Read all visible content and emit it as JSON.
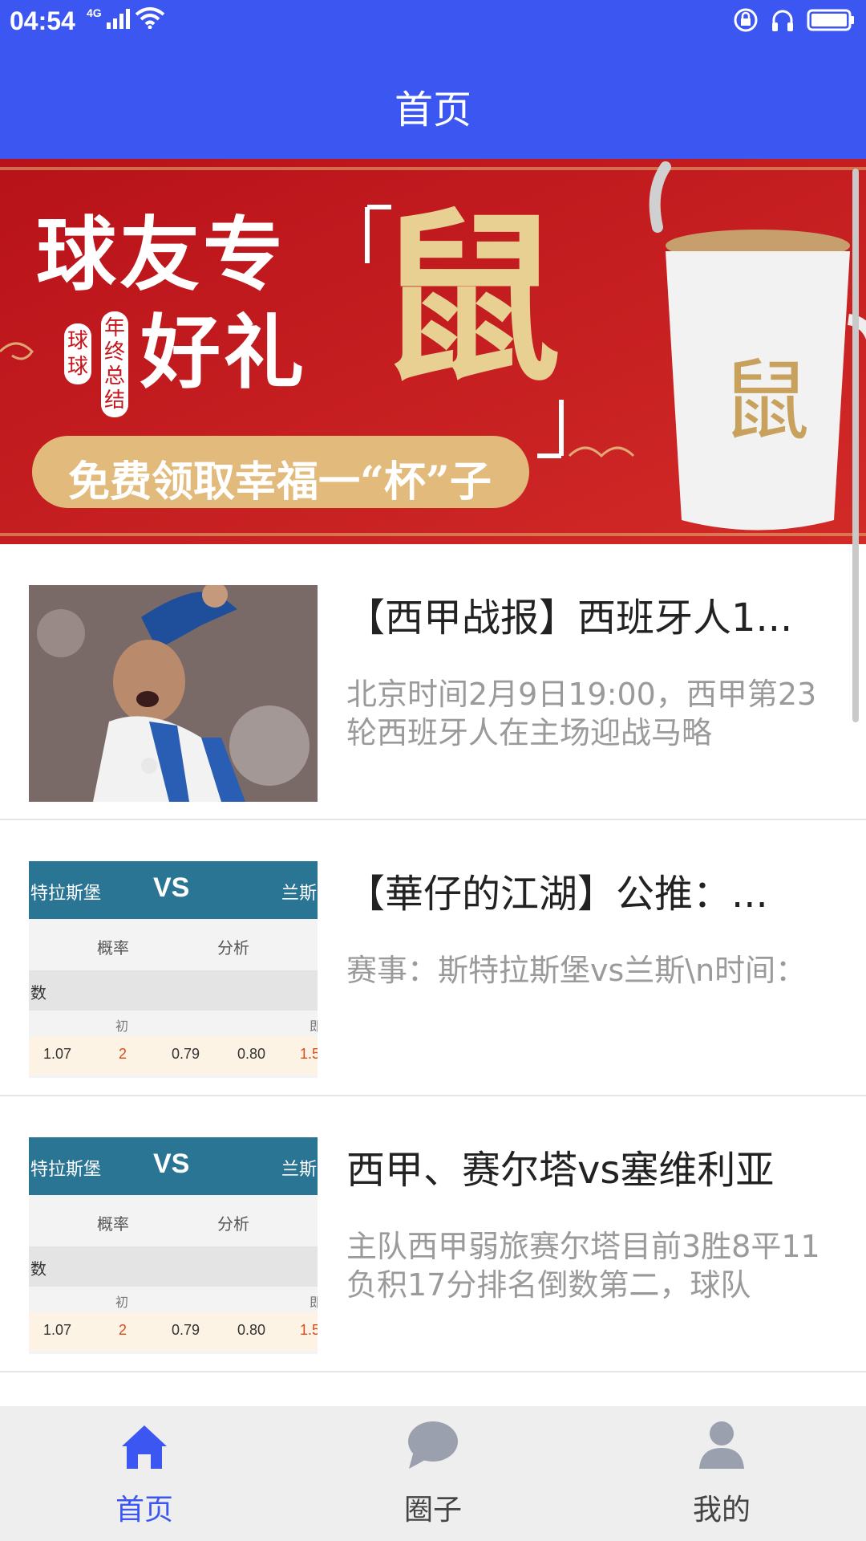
{
  "status": {
    "time": "04:54",
    "network": "4G"
  },
  "appbar": {
    "title": "首页"
  },
  "banner": {
    "headline_1": "球友专",
    "headline_2": "好礼",
    "big_char": "鼠",
    "badge_1": "球球",
    "badge_2": "年终总结",
    "subtitle": "免费领取幸福一“杯”子"
  },
  "articles": [
    {
      "title": "【西甲战报】西班牙人1...",
      "desc": "北京时间2月9日19:00，西甲第23轮西班牙人在主场迎战马略"
    },
    {
      "title": "【華仔的江湖】公推：...",
      "desc": "赛事：斯特拉斯堡vs兰斯\\n时间：",
      "thumb": {
        "team_left": "特拉斯堡",
        "vs": "VS",
        "team_right": "兰斯",
        "col1": "概率",
        "col2": "分析",
        "row_label": "数",
        "sub": "初",
        "sub2": "即",
        "values": [
          "1.07",
          "2",
          "0.79",
          "0.80",
          "1.5"
        ]
      }
    },
    {
      "title": "西甲、赛尔塔vs塞维利亚",
      "desc": "主队西甲弱旅赛尔塔目前3胜8平11负积17分排名倒数第二，球队",
      "thumb": {
        "team_left": "特拉斯堡",
        "vs": "VS",
        "team_right": "兰斯",
        "col1": "概率",
        "col2": "分析",
        "row_label": "数",
        "sub": "初",
        "sub2": "即",
        "values": [
          "1.07",
          "2",
          "0.79",
          "0.80",
          "1.5"
        ]
      }
    }
  ],
  "tabs": [
    {
      "label": "首页",
      "icon": "home-icon",
      "active": true
    },
    {
      "label": "圈子",
      "icon": "chat-bubble-icon",
      "active": false
    },
    {
      "label": "我的",
      "icon": "person-icon",
      "active": false
    }
  ],
  "colors": {
    "primary": "#3c56f2",
    "inactive": "#9aa0ad",
    "banner_red": "#c8161d",
    "gold": "#e7c98a"
  }
}
